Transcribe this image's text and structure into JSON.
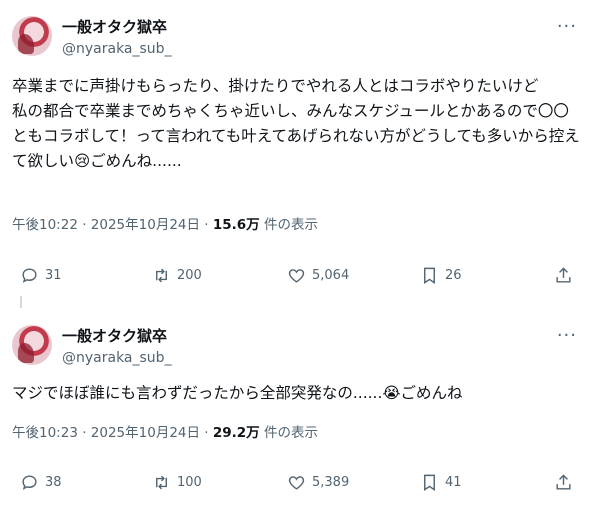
{
  "tweets": [
    {
      "name": "一般オタク獄卒",
      "handle": "@nyaraka_sub_",
      "text": "卒業までに声掛けもらったり、掛けたりでやれる人とはコラボやりたいけど\n私の都合で卒業までめちゃくちゃ近いし、みんなスケジュールとかあるので〇〇ともコラボして！って言われても叶えてあげられない方がどうしても多いから控えて欲しい😢ごめんね......",
      "time": "午後10:22 · 2025年10月24日 · ",
      "views": "15.6万",
      "views_suffix": " 件の表示",
      "replies": "31",
      "retweets": "200",
      "likes": "5,064",
      "bookmarks": "26"
    },
    {
      "name": "一般オタク獄卒",
      "handle": "@nyaraka_sub_",
      "text": "マジでほぼ誰にも言わずだったから全部突発なの......😭ごめんね",
      "time": "午後10:23 · 2025年10月24日 · ",
      "views": "29.2万",
      "views_suffix": " 件の表示",
      "replies": "38",
      "retweets": "100",
      "likes": "5,389",
      "bookmarks": "41"
    }
  ],
  "icons": {
    "more": "more-icon",
    "reply": "reply-icon",
    "retweet": "retweet-icon",
    "like": "heart-icon",
    "bookmark": "bookmark-icon",
    "share": "share-icon"
  },
  "colors": {
    "text": "#0f1419",
    "muted": "#536471"
  }
}
